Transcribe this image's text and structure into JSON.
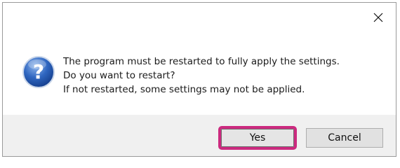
{
  "dialog": {
    "close_icon": "close-icon",
    "icon": "question-icon",
    "message_lines": [
      "The program must be restarted to fully apply the settings.",
      "Do you want to restart?",
      "If not restarted, some settings may not be applied."
    ],
    "buttons": {
      "yes_label": "Yes",
      "cancel_label": "Cancel"
    },
    "highlight_color": "#cc2a7f",
    "icon_color": "#1f4f9e"
  }
}
